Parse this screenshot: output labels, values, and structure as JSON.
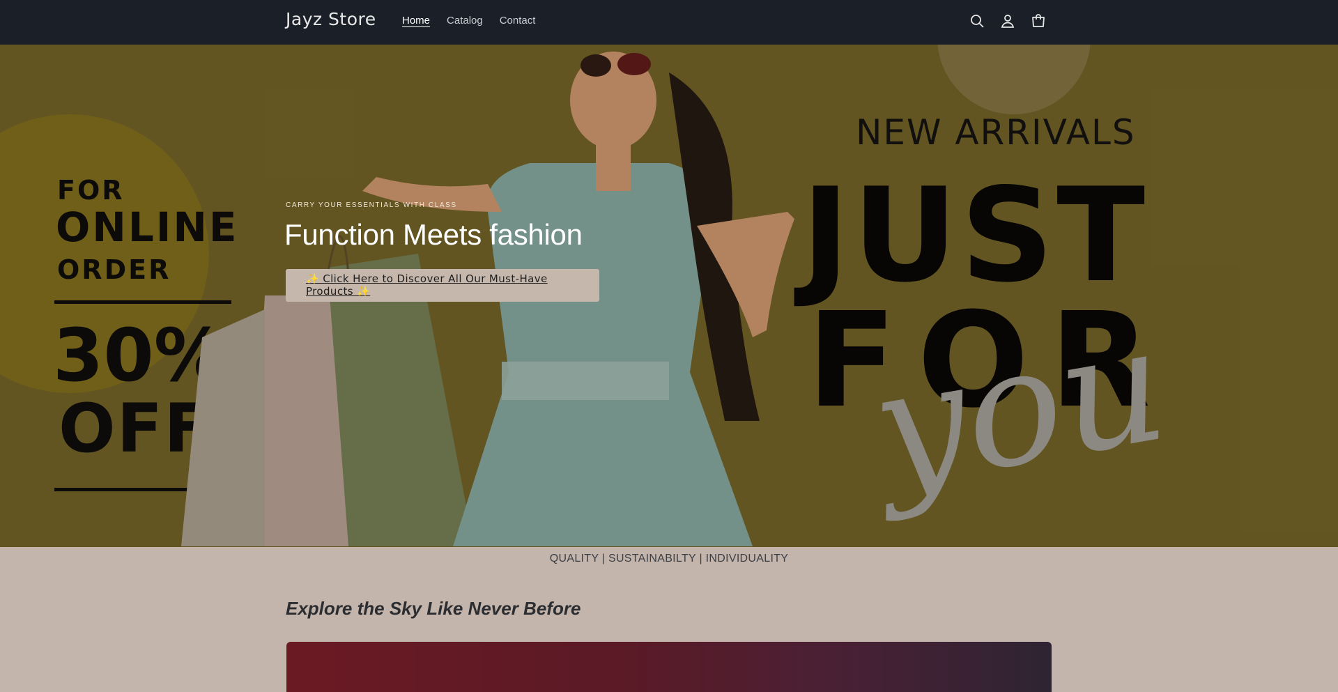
{
  "header": {
    "brand": "Jayz Store",
    "nav": [
      {
        "label": "Home",
        "active": true
      },
      {
        "label": "Catalog"
      },
      {
        "label": "Contact"
      }
    ],
    "icons": [
      "search-icon",
      "account-icon",
      "cart-icon"
    ]
  },
  "hero": {
    "art": {
      "left_lines": [
        "FOR",
        "ONLINE",
        "ORDER",
        "30%",
        "OFF"
      ],
      "right_lines": [
        "NEW ARRIVALS",
        "JUST",
        "FOR",
        "you"
      ]
    },
    "eyebrow": "CARRY YOUR ESSENTIALS WITH CLASS",
    "title": "Function Meets fashion",
    "button_label": "✨ Click Here to Discover All Our Must-Have Products ✨"
  },
  "values_strip": "QUALITY | SUSTAINABILTY | INDIVIDUALITY",
  "section": {
    "title": "Explore the Sky Like Never Before"
  },
  "colors": {
    "header_bg": "#1b1f28",
    "hero_bg": "#6c5f27",
    "page_bg": "#c4b5ac",
    "button_bg": "#c6b7ad"
  }
}
